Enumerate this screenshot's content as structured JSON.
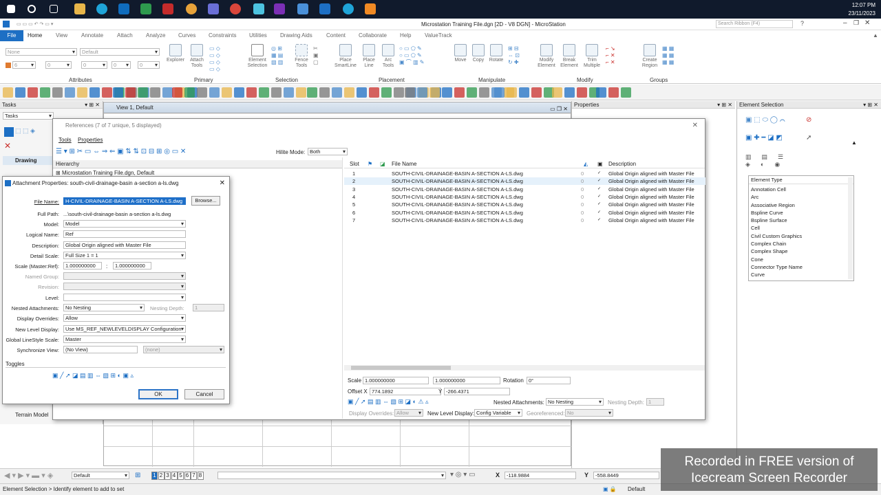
{
  "taskbar": {
    "time": "12:07 PM",
    "date": "23/11/2023"
  },
  "app": {
    "title": "Microstation Training File.dgn [2D - V8 DGN] - MicroStation",
    "search_placeholder": "Search Ribbon (F4)"
  },
  "ribbon": {
    "file_tab": "File",
    "tabs": [
      "Home",
      "View",
      "Annotate",
      "Attach",
      "Analyze",
      "Curves",
      "Constraints",
      "Utilities",
      "Drawing Aids",
      "Content",
      "Collaborate",
      "Help",
      "ValueTrack"
    ],
    "attributes": {
      "level": "None",
      "style": "Default",
      "color": "6",
      "weight": "0",
      "linestyle": "0",
      "transparency": "0"
    },
    "groups": [
      "Attributes",
      "Primary",
      "Selection",
      "Placement",
      "Manipulate",
      "Modify",
      "Groups"
    ],
    "buttons": {
      "explorer": "Explorer",
      "attach_tools": "Attach Tools",
      "element_selection": "Element Selection",
      "fence_tools": "Fence Tools",
      "place_smartline": "Place SmartLine",
      "place_line": "Place Line",
      "arc_tools": "Arc Tools",
      "move": "Move",
      "copy": "Copy",
      "rotate": "Rotate",
      "modify_element": "Modify Element",
      "break_element": "Break Element",
      "trim_multiple": "Trim Multiple",
      "create_region": "Create Region"
    }
  },
  "tasks_panel": {
    "title": "Tasks",
    "dropdown": "Tasks",
    "section": "Drawing",
    "footer": "Terrain Model"
  },
  "view": {
    "title": "View 1, Default"
  },
  "properties_panel": {
    "title": "Properties"
  },
  "element_selection": {
    "title": "Element Selection",
    "list_header": "Element Type",
    "items": [
      "Annotation Cell",
      "Arc",
      "Associative Region",
      "Bspline Curve",
      "Bspline Surface",
      "Cell",
      "Civil Custom Graphics",
      "Complex Chain",
      "Complex Shape",
      "Cone",
      "Connector Type Name",
      "Curve"
    ]
  },
  "references": {
    "title": "References (7 of 7 unique, 5 displayed)",
    "menu": [
      "Tools",
      "Properties"
    ],
    "hilite_label": "Hilite Mode:",
    "hilite_value": "Both",
    "hierarchy_label": "Hierarchy",
    "hierarchy_item": "Microstation Training File.dgn, Default",
    "columns": [
      "Slot",
      "File Name",
      "Description"
    ],
    "rows": [
      {
        "slot": "1",
        "file": "SOUTH-CIVIL-DRAINAGE-BASIN A-SECTION A-LS.dwg",
        "num": "0",
        "desc": "Global Origin aligned with Master File"
      },
      {
        "slot": "2",
        "file": "SOUTH-CIVIL-DRAINAGE-BASIN A-SECTION A-LS.dwg",
        "num": "0",
        "desc": "Global Origin aligned with Master File"
      },
      {
        "slot": "3",
        "file": "SOUTH-CIVIL-DRAINAGE-BASIN A-SECTION A-LS.dwg",
        "num": "0",
        "desc": "Global Origin aligned with Master File"
      },
      {
        "slot": "4",
        "file": "SOUTH-CIVIL-DRAINAGE-BASIN A-SECTION A-LS.dwg",
        "num": "0",
        "desc": "Global Origin aligned with Master File"
      },
      {
        "slot": "5",
        "file": "SOUTH-CIVIL-DRAINAGE-BASIN A-SECTION A-LS.dwg",
        "num": "0",
        "desc": "Global Origin aligned with Master File"
      },
      {
        "slot": "6",
        "file": "SOUTH-CIVIL-DRAINAGE-BASIN A-SECTION A-LS.dwg",
        "num": "0",
        "desc": "Global Origin aligned with Master File"
      },
      {
        "slot": "7",
        "file": "SOUTH-CIVIL-DRAINAGE-BASIN A-SECTION A-LS.dwg",
        "num": "0",
        "desc": "Global Origin aligned with Master File"
      }
    ],
    "bottom": {
      "scale_label": "Scale",
      "scale1": "1.000000000",
      "scale2": "1.000000000",
      "rotation_label": "Rotation",
      "rotation": "0°",
      "offset_x_label": "Offset X",
      "offset_x": "774.1892",
      "offset_y_label": "Y",
      "offset_y": "-266.4371",
      "nested_label": "Nested Attachments:",
      "nested": "No Nesting",
      "depth_label": "Nesting Depth:",
      "depth": "1",
      "display_overrides_label": "Display Overrides:",
      "display_overrides": "Allow",
      "new_level_label": "New Level Display:",
      "new_level": "Config Variable",
      "georef_label": "Georeferenced:",
      "georef": "No"
    }
  },
  "attach_dialog": {
    "title": "Attachment Properties: south-civil-drainage-basin a-section a-ls.dwg",
    "file_name_label": "File Name:",
    "file_name": "H-CIVIL-DRAINAGE-BASIN A-SECTION A-LS.dwg",
    "browse": "Browse...",
    "full_path_label": "Full Path:",
    "full_path": "...\\south-civil-drainage-basin a-section a-ls.dwg",
    "model_label": "Model:",
    "model": "Model",
    "logical_label": "Logical Name:",
    "logical": "Ref",
    "desc_label": "Description:",
    "desc": "Global Origin aligned with Master File",
    "detail_label": "Detail Scale:",
    "detail": "Full Size 1 = 1",
    "scale_label": "Scale (Master:Ref):",
    "scale1": "1.000000000",
    "scale_sep": ":",
    "scale2": "1.000000000",
    "named_group_label": "Named Group:",
    "revision_label": "Revision:",
    "level_label": "Level:",
    "nested_label": "Nested Attachments:",
    "nested": "No Nesting",
    "depth_label": "Nesting Depth:",
    "depth": "1",
    "display_label": "Display Overrides:",
    "display": "Allow",
    "newlevel_label": "New Level Display:",
    "newlevel": "Use MS_REF_NEWLEVELDISPLAY Configuration",
    "linestyle_label": "Global LineStyle Scale:",
    "linestyle": "Master",
    "sync_label": "Synchronize View:",
    "sync": "(No View)",
    "sync2": "(none)",
    "toggles_label": "Toggles",
    "ok": "OK",
    "cancel": "Cancel"
  },
  "nav": {
    "model": "Default",
    "views": [
      "1",
      "2",
      "3",
      "4",
      "5",
      "6",
      "7",
      "8"
    ],
    "x_label": "X",
    "x": "-118.9884",
    "y_label": "Y",
    "y": "-558.8449"
  },
  "status": {
    "prompt": "Element Selection > Identify element to add to set",
    "model": "Default"
  },
  "watermark": {
    "line1": "Recorded in FREE version of",
    "line2": "Icecream   Screen   Recorder"
  }
}
